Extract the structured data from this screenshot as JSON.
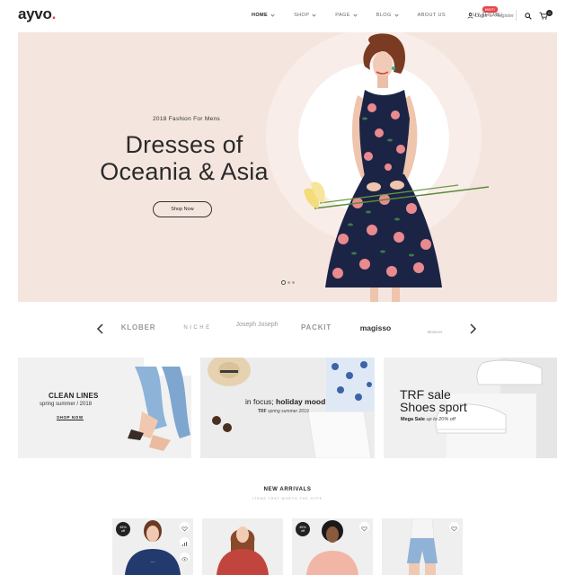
{
  "header": {
    "logo_text": "ayvo",
    "logo_dot": ".",
    "nav": [
      {
        "label": "HOME",
        "has_dropdown": true
      },
      {
        "label": "SHOP",
        "has_dropdown": true
      },
      {
        "label": "PAGE",
        "has_dropdown": true
      },
      {
        "label": "BLOG",
        "has_dropdown": true
      },
      {
        "label": "ABOUT US",
        "has_dropdown": false
      },
      {
        "label": "BUY THEME!",
        "has_dropdown": false
      }
    ],
    "hot_badge": "HOT!",
    "login": "Login",
    "or": "or",
    "register": "Register",
    "cart_count": "0"
  },
  "hero": {
    "subtitle": "2018 Fashion For Mens",
    "title_line1": "Dresses of",
    "title_line2": "Oceania & Asia",
    "button": "Shop Now",
    "slides": 3,
    "active_slide": 1
  },
  "brands": [
    "KLOBER",
    "NICHE",
    "Joseph Joseph",
    "PACKIT",
    "magisso",
    "Miseens"
  ],
  "promos": {
    "tile1": {
      "title": "CLEAN LINES",
      "subtitle": "spring summer / 2018",
      "link": "SHOP NOW"
    },
    "tile2": {
      "title_prefix": "in focus;",
      "title_bold": "holiday mood",
      "sub_bold": "TRF",
      "sub_rest": "spring summer 2019"
    },
    "tile3": {
      "title_line1": "TRF sale",
      "title_line2": "Shoes sport",
      "sub_bold": "Mega Sale",
      "sub_rest": "up to 20% off"
    }
  },
  "new_arrivals": {
    "title": "NEW ARRIVALS",
    "subtitle": "ITEMS THAT WORTH THE HYPE",
    "badge_1": "45%",
    "badge_2": "off",
    "products": [
      {
        "badge": true
      },
      {
        "badge": false
      },
      {
        "badge": true
      },
      {
        "badge": false
      }
    ]
  },
  "colors": {
    "accent": "#e8444a",
    "hero_bg": "#f4e6df",
    "text": "#222222"
  }
}
